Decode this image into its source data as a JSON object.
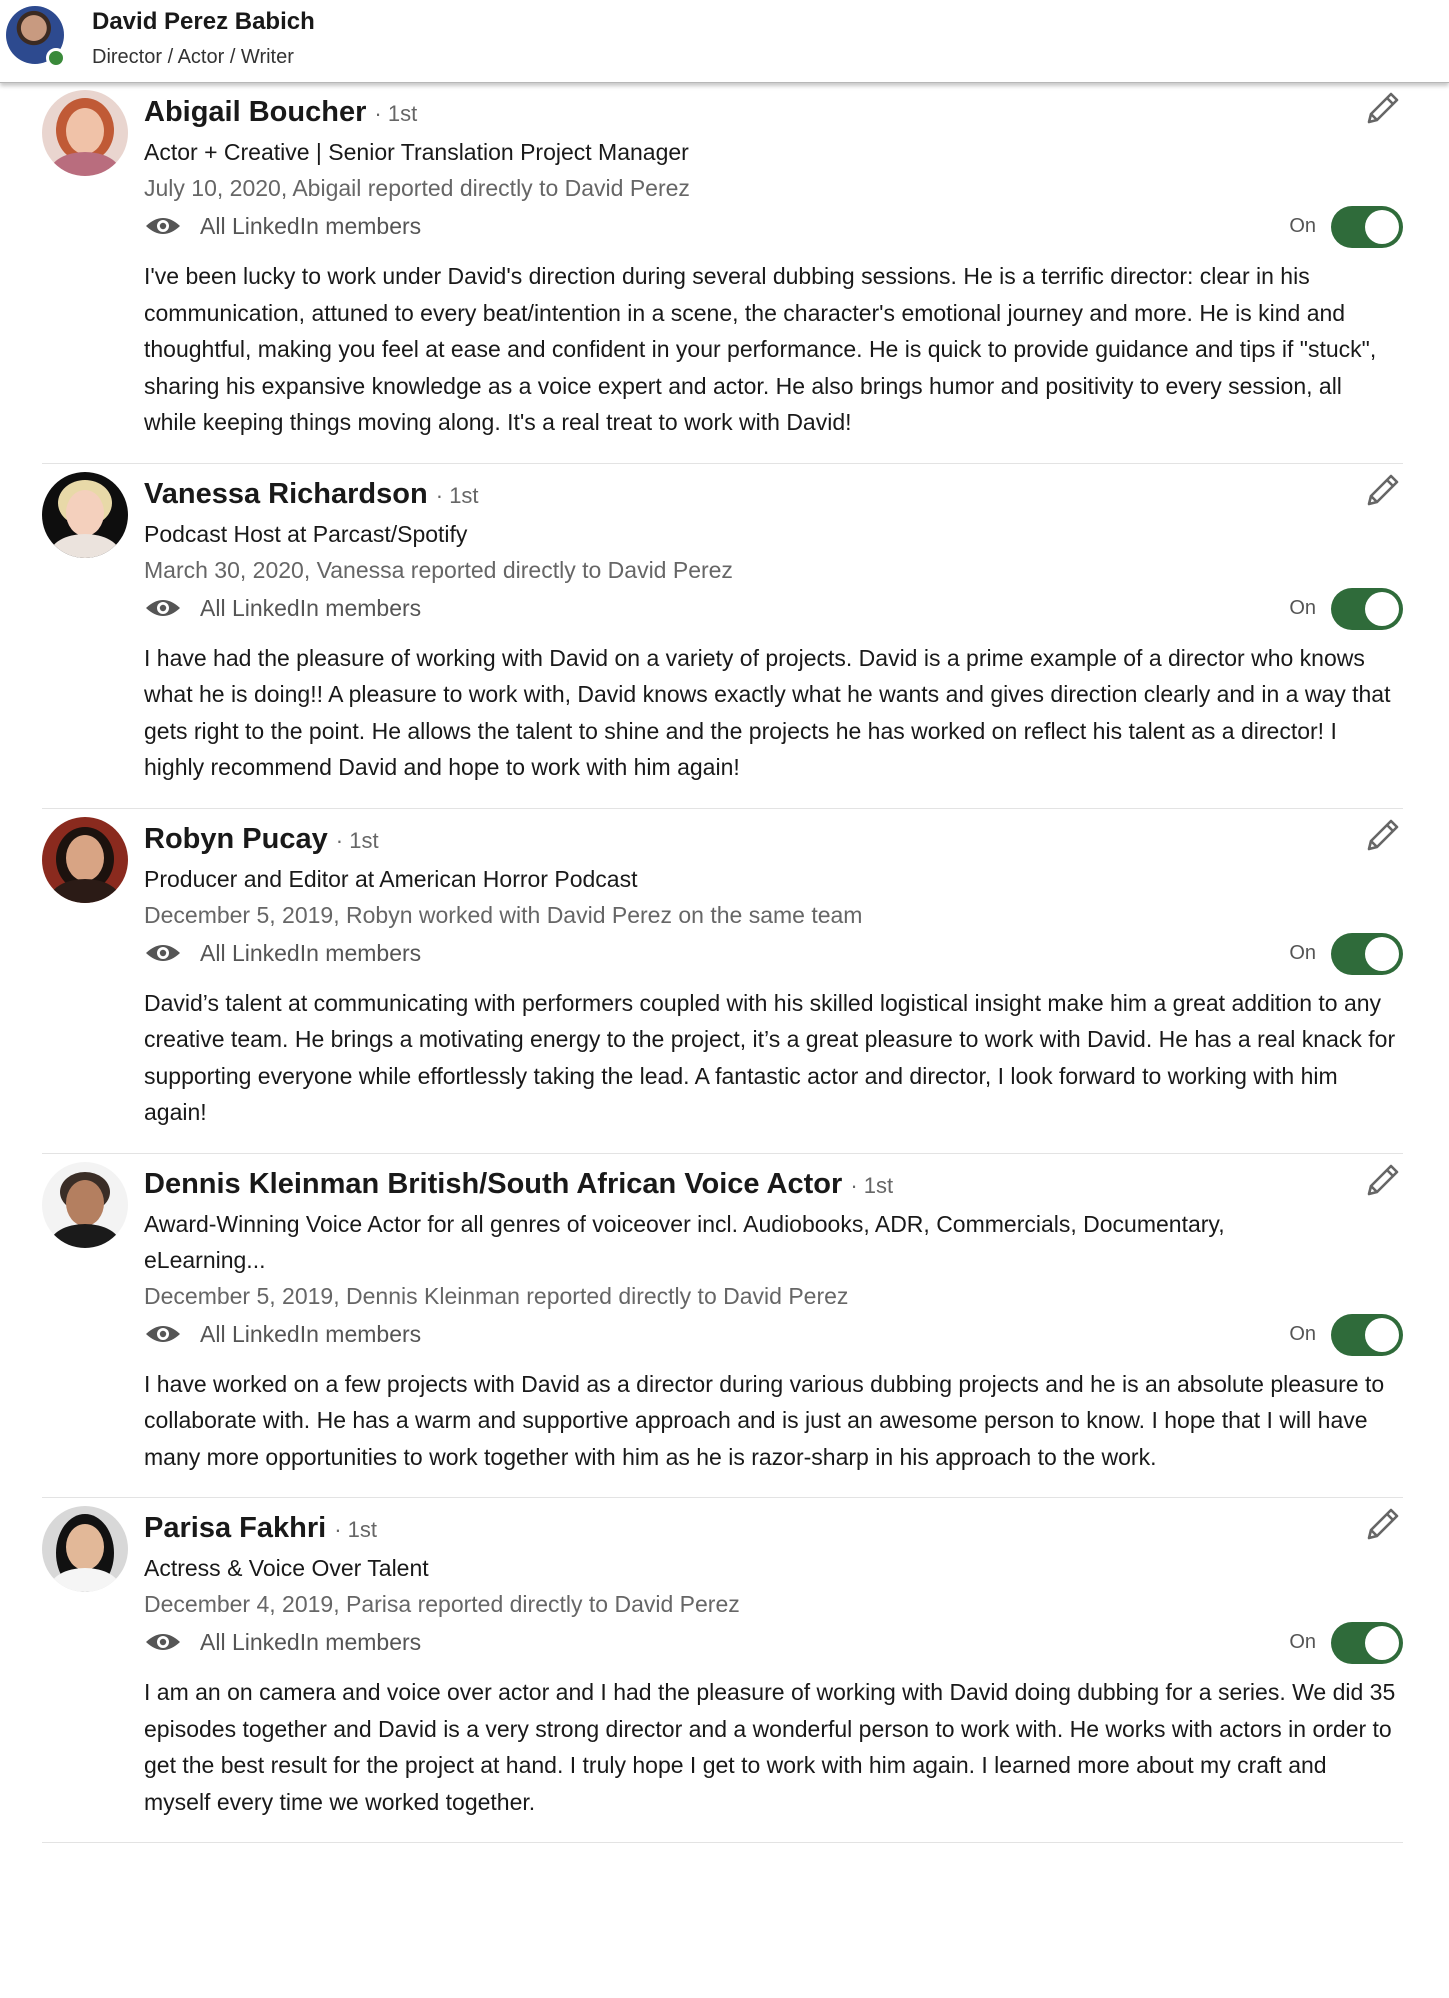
{
  "profile": {
    "name": "David Perez Babich",
    "subtitle": "Director / Actor / Writer"
  },
  "recommendations": [
    {
      "name": "Abigail Boucher",
      "degree": "· 1st",
      "headline": "Actor + Creative | Senior Translation Project Manager",
      "date_line": "July 10, 2020, Abigail reported directly to David Perez",
      "visibility": "All LinkedIn members",
      "toggle_label": "On",
      "toggle_on": true,
      "text": "I've been lucky to work under David's direction during several dubbing sessions. He is a terrific director: clear in his communication, attuned to every beat/intention in a scene, the character's emotional journey and more. He is kind and thoughtful, making you feel at ease and confident in your performance. He is quick to provide guidance and tips if \"stuck\", sharing his expansive knowledge as a voice expert and actor. He also brings humor and positivity to every session, all while keeping things moving along. It's a real treat to work with David!"
    },
    {
      "name": "Vanessa Richardson",
      "degree": "· 1st",
      "headline": "Podcast Host at Parcast/Spotify",
      "date_line": "March 30, 2020, Vanessa reported directly to David Perez",
      "visibility": "All LinkedIn members",
      "toggle_label": "On",
      "toggle_on": true,
      "text": "I have had the pleasure of working with David on a variety of projects. David is a prime example of a director who knows what he is doing!! A pleasure to work with, David knows exactly what he wants and gives direction clearly and in a way that gets right to the point. He allows the talent to shine and the projects he has worked on reflect his talent as a director! I highly recommend David and hope to work with him again!"
    },
    {
      "name": "Robyn Pucay",
      "degree": "· 1st",
      "headline": "Producer and Editor at American Horror Podcast",
      "date_line": "December 5, 2019, Robyn worked with David Perez on the same team",
      "visibility": "All LinkedIn members",
      "toggle_label": "On",
      "toggle_on": true,
      "text": "David’s talent at communicating with performers coupled with his skilled logistical insight make him a great addition to any creative team. He brings a motivating energy to the project, it’s a great pleasure to work with David. He has a real knack for supporting everyone while effortlessly taking the lead. A fantastic actor and director, I look forward to working with him again!"
    },
    {
      "name": "Dennis Kleinman British/South African Voice Actor",
      "degree": "· 1st",
      "headline": "Award-Winning Voice Actor for all genres of voiceover incl. Audiobooks, ADR, Commercials, Documentary, eLearning...",
      "date_line": "December 5, 2019, Dennis Kleinman reported directly to David Perez",
      "visibility": "All LinkedIn members",
      "toggle_label": "On",
      "toggle_on": true,
      "text": "I have worked on a few projects with David as a director during various dubbing projects and he is an absolute pleasure to collaborate with. He has a warm and supportive approach and is just an awesome person to know. I hope that I will have many more opportunities to work together with him as he is razor-sharp in his approach to the work."
    },
    {
      "name": "Parisa Fakhri",
      "degree": "· 1st",
      "headline": "Actress & Voice Over Talent",
      "date_line": "December 4, 2019, Parisa reported directly to David Perez",
      "visibility": "All LinkedIn members",
      "toggle_label": "On",
      "toggle_on": true,
      "text": "I am an on camera and voice over actor and I had the pleasure of working with David doing dubbing for a series. We did 35 episodes together and David is a very strong director and a wonderful person to work with. He works with actors in order to get the best result for the project at hand. I truly hope I get to work with him again. I learned more about my craft and myself every time we worked together."
    }
  ],
  "icons": {
    "edit": "pencil-icon",
    "visibility": "eye-icon"
  },
  "colors": {
    "toggle_on": "#2f6b3a",
    "online": "#3a8a3a"
  }
}
